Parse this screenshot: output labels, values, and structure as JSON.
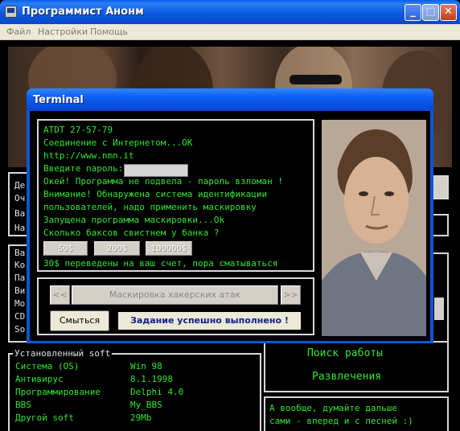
{
  "window": {
    "title": "Программист Анонм",
    "minimize": "_",
    "maximize": "□",
    "close": "✕"
  },
  "menu": [
    "Файл",
    "Настройки",
    "Помощь"
  ],
  "left_panel_a": {
    "letters": [
      "Де",
      "Оч",
      "Ва",
      "На"
    ]
  },
  "left_panel_b": {
    "letters": [
      "Ва",
      "Ко",
      "Па",
      "Ви",
      "Мо",
      "CD",
      "So"
    ]
  },
  "installed_soft": {
    "legend": "Установленный soft",
    "rows": [
      {
        "label": "Система (OS)",
        "value": "Win 98"
      },
      {
        "label": "Антивирус",
        "value": "8.1.1998"
      },
      {
        "label": "Программирование",
        "value": "Delphi 4.0"
      },
      {
        "label": "BBS",
        "value": "My_BBS"
      },
      {
        "label": "Другой soft",
        "value": "29Mb"
      }
    ]
  },
  "right_menu": {
    "job": "Поиск работы",
    "fun": "Развлечения"
  },
  "tip": {
    "line1": "А вообще, думайте дальше",
    "line2": "сами - вперед и с песней :)"
  },
  "dialog": {
    "title": "Terminal",
    "lines": [
      "ATDT 27-57-79",
      "Соединение с Интернетом...OK",
      "http://www.nmn.it",
      "Введите пароль:",
      "Окей! Программа не подвела - пароль взломан !",
      "Внимание! Обнаружена система идентификации",
      "пользователей, надо применить маскировку",
      "Запущена программа маскировки...Ok",
      "Сколько баксов свистнем у банка ?",
      "30$ переведены на ваш счет, пора сматываться"
    ],
    "password_value": "",
    "amounts": [
      "50$",
      "200$",
      "100000$"
    ],
    "prev": "<<",
    "next": ">>",
    "masking": "Маскировка хакерских атак",
    "escape": "Смыться",
    "done": "Задание успешно выполнено !"
  },
  "colors": {
    "terminal_green": "#2fe52f",
    "xp_blue": "#0a57d8"
  }
}
